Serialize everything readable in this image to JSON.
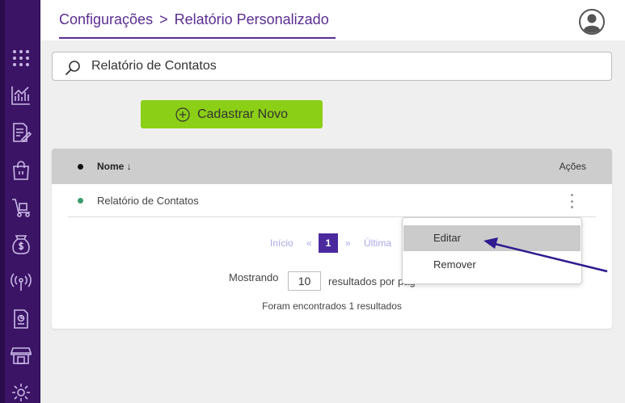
{
  "breadcrumb": {
    "parent": "Configurações",
    "separator": ">",
    "current": "Relatório Personalizado"
  },
  "header": {
    "avatar_icon": "user-circle-icon"
  },
  "sidebar": {
    "items": [
      {
        "icon": "apps-grid-icon"
      },
      {
        "icon": "chart-icon"
      },
      {
        "icon": "document-edit-icon"
      },
      {
        "icon": "shopping-bag-icon"
      },
      {
        "icon": "hand-truck-icon"
      },
      {
        "icon": "money-bag-icon"
      },
      {
        "icon": "broadcast-icon"
      },
      {
        "icon": "report-icon"
      },
      {
        "icon": "store-icon"
      },
      {
        "icon": "gear-icon"
      }
    ]
  },
  "search": {
    "value": "Relatório de Contatos",
    "icon": "search-icon"
  },
  "toolbar": {
    "new_label": "Cadastrar Novo"
  },
  "table": {
    "headers": {
      "name": "Nome",
      "sort_indicator": "↓",
      "actions": "Ações"
    },
    "rows": [
      {
        "name": "Relatório de Contatos",
        "status_color": "#3a9b6b"
      }
    ]
  },
  "pagination": {
    "first": "Início",
    "prev": "«",
    "current": "1",
    "next": "»",
    "last": "Última"
  },
  "results": {
    "showing_label": "Mostrando",
    "per_page": "10",
    "per_page_label": "resultados por pág",
    "found_text": "Foram encontrados 1 resultados"
  },
  "context_menu": {
    "items": [
      {
        "label": "Editar"
      },
      {
        "label": "Remover"
      }
    ]
  },
  "colors": {
    "sidebar": "#3b1466",
    "accent": "#5a2d91",
    "button": "#8ccf17",
    "page_active": "#4b2a9e",
    "annotation_arrow": "#2f1a8f"
  }
}
